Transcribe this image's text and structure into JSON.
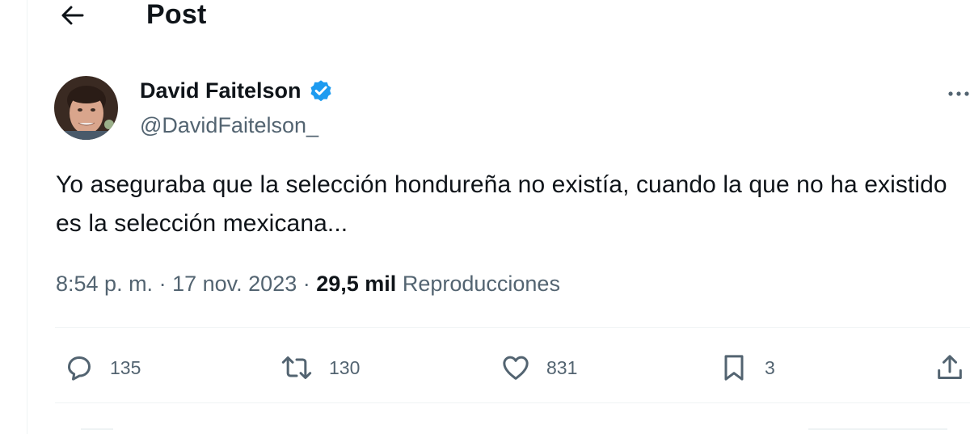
{
  "header": {
    "title": "Post"
  },
  "post": {
    "author_name": "David Faitelson",
    "handle": "@DavidFaitelson_",
    "text": "Yo aseguraba que la selección hondureña no existía, cuando la que no ha existido es la selección mexicana...",
    "time": "8:54 p. m.",
    "date": "17 nov. 2023",
    "views": "29,5 mil",
    "views_label": "Reproducciones"
  },
  "actions": {
    "replies": "135",
    "reposts": "130",
    "likes": "831",
    "bookmarks": "3"
  },
  "icons": {
    "back": "arrow-left-icon",
    "verified": "verified-badge-icon",
    "more": "more-dots-icon",
    "reply": "speech-bubble-icon",
    "repost": "repost-arrows-icon",
    "like": "heart-icon",
    "bookmark": "bookmark-icon",
    "share": "share-upload-icon"
  },
  "colors": {
    "verified": "#1d9bf0",
    "text": "#0f1419",
    "secondary": "#536471",
    "divider": "#eff3f4"
  }
}
